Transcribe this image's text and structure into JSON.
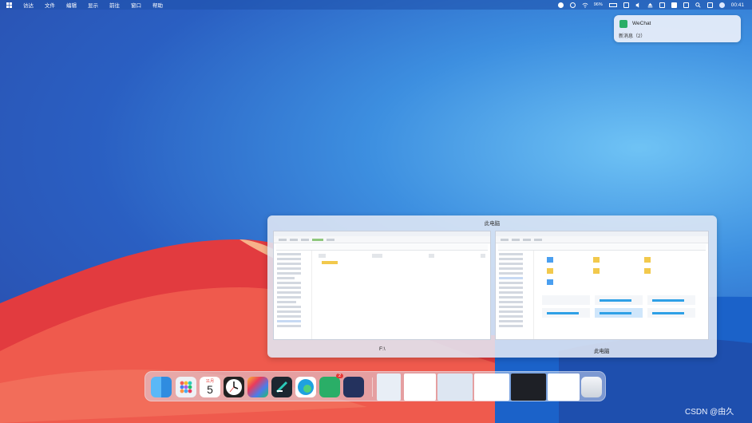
{
  "menubar": {
    "items": [
      "访达",
      "文件",
      "编辑",
      "显示",
      "前往",
      "窗口",
      "帮助"
    ],
    "battery": "96%",
    "time": "00:41"
  },
  "notification": {
    "app": "WeChat",
    "message": "新消息（2）"
  },
  "switcher": {
    "title": "此电脑",
    "windows": [
      {
        "label": "F:\\"
      },
      {
        "label": "此电脑"
      }
    ]
  },
  "dock": {
    "calendar_month": "11月",
    "calendar_day": "5",
    "wechat_badge": "2"
  },
  "watermark": "CSDN @由久",
  "colors": {
    "accent": "#2e6fd6",
    "wechat": "#2aae67"
  }
}
